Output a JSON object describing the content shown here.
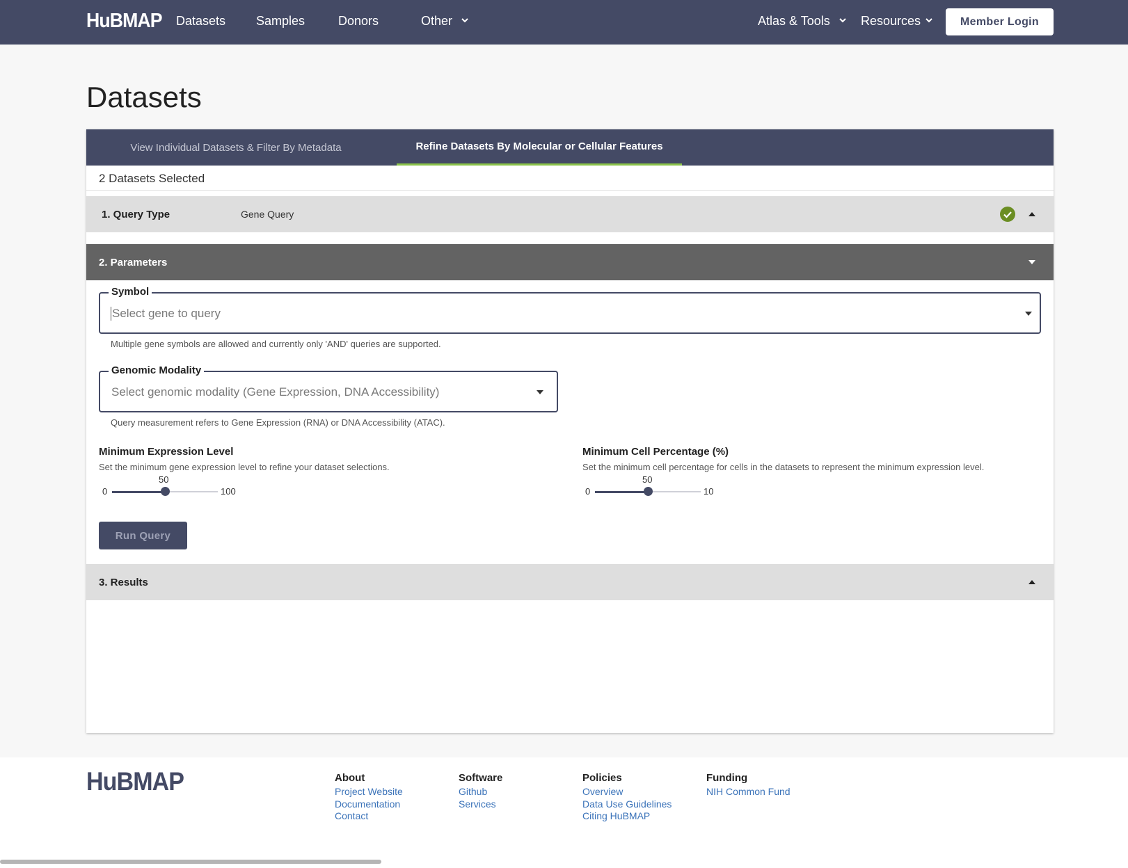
{
  "nav": {
    "logo": "HuBMAP",
    "links": [
      "Datasets",
      "Samples",
      "Donors",
      "Other"
    ],
    "right_links": [
      "Atlas & Tools",
      "Resources"
    ],
    "login": "Member Login"
  },
  "page": {
    "title": "Datasets",
    "tabs": [
      "View Individual Datasets & Filter By Metadata",
      "Refine Datasets By Molecular or Cellular Features"
    ],
    "selected_count": "2 Datasets Selected"
  },
  "query_type": {
    "title": "1. Query Type",
    "value": "Gene Query",
    "status": "complete"
  },
  "parameters": {
    "title": "2. Parameters",
    "symbol": {
      "label": "Symbol",
      "placeholder": "Select gene to query",
      "helper": "Multiple gene symbols are allowed and currently only 'AND' queries are supported."
    },
    "modality": {
      "label": "Genomic Modality",
      "placeholder": "Select genomic modality (Gene Expression, DNA Accessibility)",
      "helper": "Query measurement refers to Gene Expression (RNA) or DNA Accessibility (ATAC)."
    },
    "min_expression": {
      "title": "Minimum Expression Level",
      "desc": "Set the minimum gene expression level to refine your dataset selections.",
      "min": "0",
      "max": "100",
      "value": "50",
      "fraction": 0.5
    },
    "min_cell_pct": {
      "title": "Minimum Cell Percentage (%)",
      "desc": "Set the minimum cell percentage for cells in the datasets to represent the minimum expression level.",
      "min": "0",
      "max": "10",
      "value": "50",
      "fraction": 0.5
    },
    "run_button": "Run Query"
  },
  "results": {
    "title": "3. Results"
  },
  "footer": {
    "logo": "HuBMAP",
    "columns": [
      {
        "heading": "About",
        "links": [
          "Project Website",
          "Documentation",
          "Contact"
        ]
      },
      {
        "heading": "Software",
        "links": [
          "Github",
          "Services"
        ]
      },
      {
        "heading": "Policies",
        "links": [
          "Overview",
          "Data Use Guidelines",
          "Citing HuBMAP"
        ]
      },
      {
        "heading": "Funding",
        "links": [
          "NIH Common Fund"
        ]
      }
    ]
  },
  "colors": {
    "nav_bg": "#444a65",
    "accent_green": "#8bc34a",
    "check_green": "#6b8e23",
    "link_blue": "#3b73b9"
  }
}
